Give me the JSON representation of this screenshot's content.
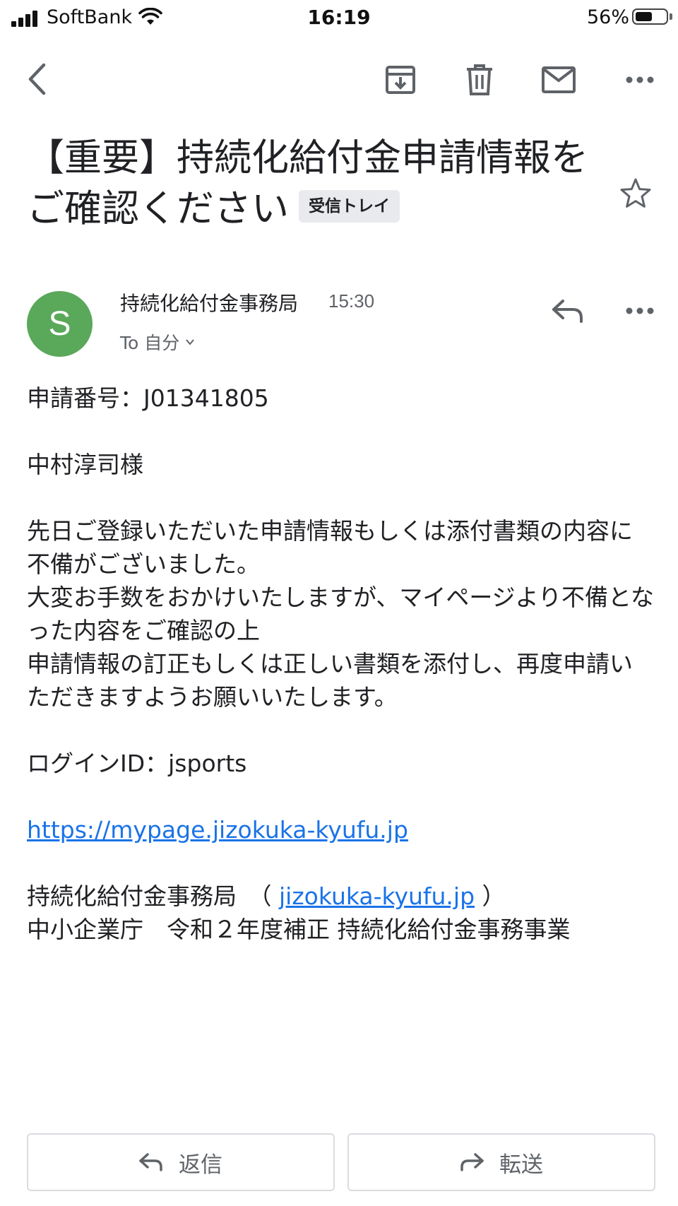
{
  "status_bar": {
    "carrier": "SoftBank",
    "time": "16:19",
    "battery_percent_text": "56%",
    "battery_level": 0.56
  },
  "toolbar": {
    "icons": [
      "back-arrow-icon",
      "archive-icon",
      "trash-icon",
      "mail-icon",
      "more-icon"
    ]
  },
  "email": {
    "subject": "【重要】持続化給付金申請情報をご確認ください",
    "label": "受信トレイ",
    "sender": {
      "avatar_letter": "S",
      "avatar_color": "#5aa85a",
      "name": "持続化給付金事務局",
      "time": "15:30",
      "recipient": "To 自分"
    },
    "body": {
      "application_number": "申請番号：J01341805",
      "addressee": "中村淳司様",
      "paragraph": [
        "先日ご登録いただいた申請情報もしくは添付書類の内容に不備がございました。",
        "大変お手数をおかけいたしますが、マイページより不備となった内容をご確認の上",
        "申請情報の訂正もしくは正しい書類を添付し、再度申請いただきますようお願いいたします。"
      ],
      "login_id": "ログインID：jsports",
      "link": "https://mypage.jizokuka-kyufu.jp",
      "footer_org_prefix": "持続化給付金事務局　（ ",
      "footer_org_link": "jizokuka-kyufu.jp",
      "footer_org_suffix": " ）",
      "footer_line2": "中小企業庁　令和２年度補正 持続化給付金事務事業"
    }
  },
  "actions": {
    "reply_label": "返信",
    "forward_label": "転送"
  },
  "colors": {
    "link": "#1a73e8",
    "avatar": "#5aa85a",
    "icon": "#5f6368"
  }
}
